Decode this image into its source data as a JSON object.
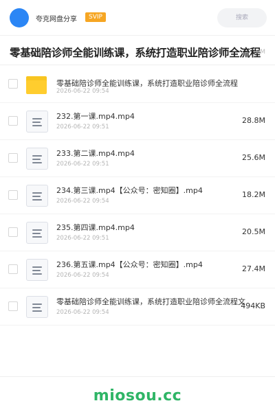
{
  "header": {
    "share_name": "夸克网盘分享",
    "badge": "SVIP",
    "search_placeholder": "搜索",
    "accent": "#2b86f5",
    "badge_color": "#f6a623"
  },
  "title": {
    "text": "零基础陪诊师全能训练课，系统打造职业陪诊师全流程",
    "size_fragment": "0M"
  },
  "files": [
    {
      "type": "folder",
      "icon": "folder-icon",
      "name": "零基础陪诊师全能训练课，系统打造职业陪诊师全流程",
      "date": "2026-06-22 09:54",
      "size": ""
    },
    {
      "type": "file",
      "icon": "document-icon",
      "name": "232.第一课.mp4.mp4",
      "date": "2026-06-22 09:51",
      "size": "28.8M"
    },
    {
      "type": "file",
      "icon": "document-icon",
      "name": "233.第二课.mp4.mp4",
      "date": "2026-06-22 09:51",
      "size": "25.6M"
    },
    {
      "type": "file",
      "icon": "document-icon",
      "name": "234.第三课.mp4【公众号：密知圈】.mp4",
      "date": "2026-06-22 09:54",
      "size": "18.2M"
    },
    {
      "type": "file",
      "icon": "document-icon",
      "name": "235.第四课.mp4.mp4",
      "date": "2026-06-22 09:51",
      "size": "20.5M"
    },
    {
      "type": "file",
      "icon": "document-icon",
      "name": "236.第五课.mp4【公众号：密知圈】.mp4",
      "date": "2026-06-22 09:54",
      "size": "27.4M"
    },
    {
      "type": "file",
      "icon": "document-icon",
      "name": "零基础陪诊师全能训练课，系统打造职业陪诊师全流程文",
      "date": "2026-06-22 09:54",
      "size": "494KB"
    }
  ],
  "watermark": "miosou.cc"
}
